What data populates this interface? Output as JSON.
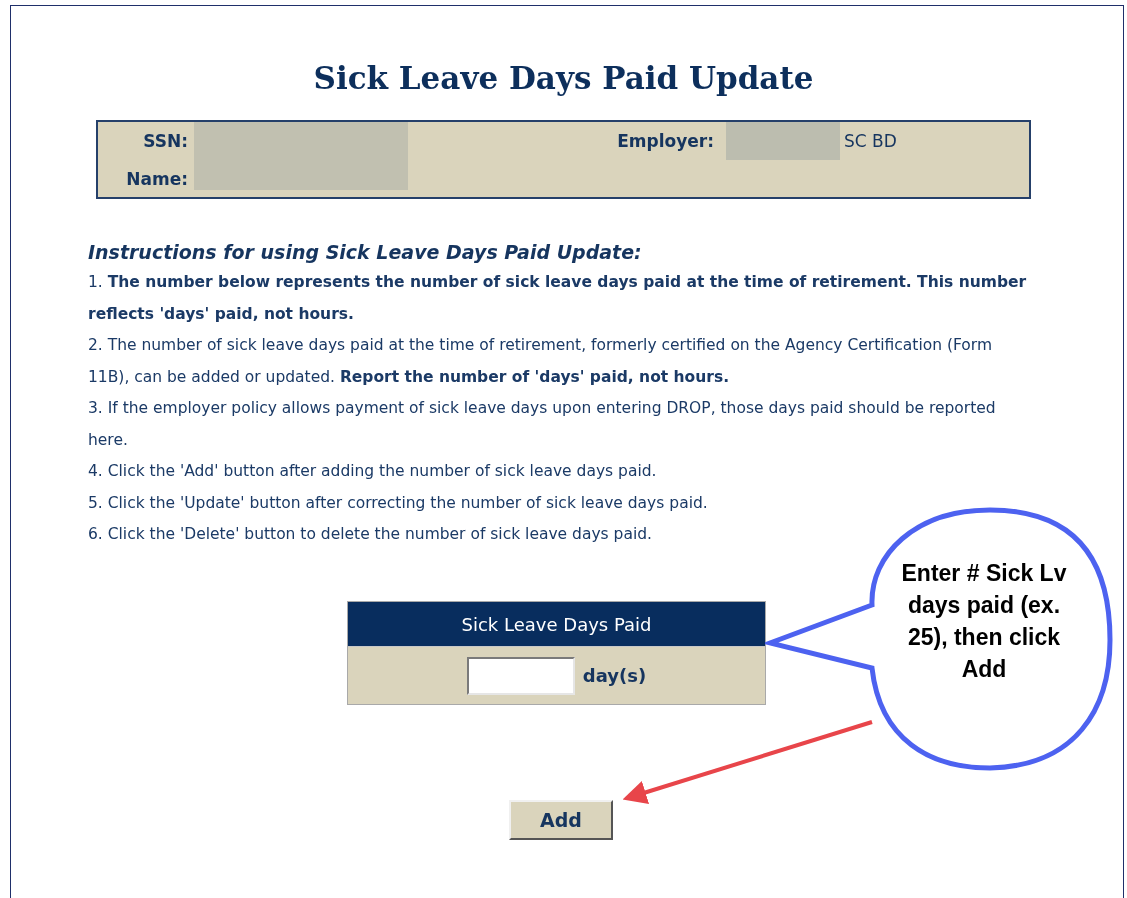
{
  "title": "Sick Leave Days Paid Update",
  "member_info": {
    "ssn_label": "SSN:",
    "name_label": "Name:",
    "employer_label": "Employer:",
    "employer_suffix": "SC BD"
  },
  "instructions": {
    "heading": "Instructions for using Sick Leave Days Paid Update:",
    "items": [
      "1. **The number below represents the number of sick leave days paid at the time of retirement. This number reflects 'days' paid, not hours.**",
      "2. The number of sick leave days paid at the time of retirement, formerly certified on the Agency Certification (Form 11B), can be added or updated. **Report the number of 'days' paid, not hours.**",
      "3. If the employer policy allows payment of sick leave days upon entering DROP, those days paid should be reported here.",
      "4. Click the 'Add' button after adding the number of sick leave days paid.",
      "5. Click the 'Update' button after correcting the number of sick leave days paid.",
      "6. Click the 'Delete' button to delete the number of sick leave days paid."
    ]
  },
  "days_table": {
    "header": "Sick Leave Days Paid",
    "unit": "day(s)"
  },
  "buttons": [
    "Add"
  ],
  "callout": {
    "text": "Enter # Sick Lv days paid (ex. 25), then click Add"
  }
}
